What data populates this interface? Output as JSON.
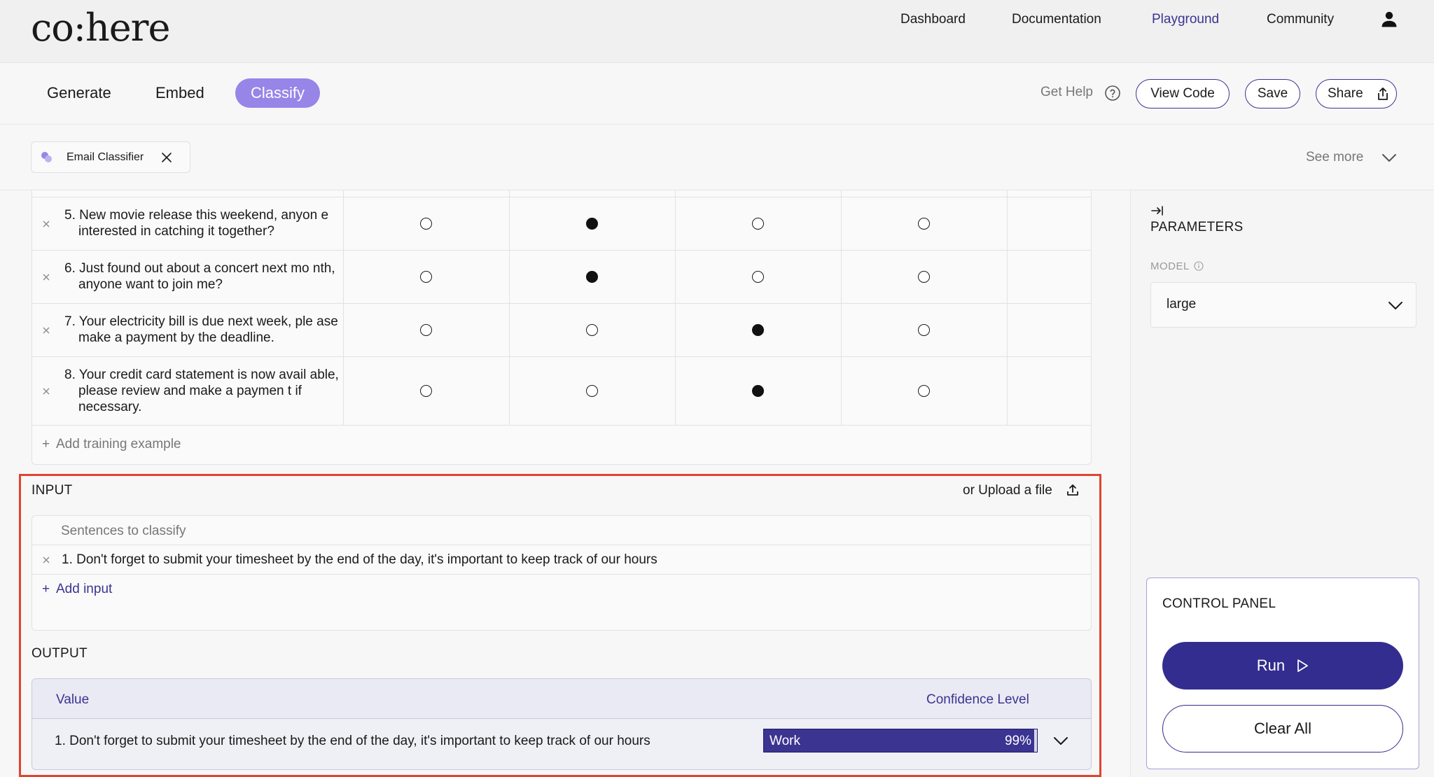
{
  "brand": {
    "logo": "co:here"
  },
  "nav": {
    "links": [
      {
        "label": "Dashboard"
      },
      {
        "label": "Documentation"
      },
      {
        "label": "Playground"
      },
      {
        "label": "Community"
      }
    ],
    "active": "Playground",
    "user_icon": "user-icon"
  },
  "tabs": {
    "items": [
      {
        "label": "Generate"
      },
      {
        "label": "Embed"
      },
      {
        "label": "Classify"
      }
    ],
    "active": "Classify",
    "get_help": "Get Help",
    "view_code": "View Code",
    "save": "Save",
    "share": "Share"
  },
  "preset": {
    "name": "Email Classifier",
    "see_more": "See more"
  },
  "examples": {
    "rows": [
      {
        "text": "5. New movie release this weekend, anyon e interested in catching it together?",
        "selected": 1
      },
      {
        "text": "6. Just found out about a concert next mo nth, anyone want to join me?",
        "selected": 1
      },
      {
        "text": "7. Your electricity bill is due next week, ple ase make a payment by the deadline.",
        "selected": 2
      },
      {
        "text": "8. Your credit card statement is now avail able, please review and make a paymen t if necessary.",
        "selected": 2
      }
    ],
    "add_label": "Add training example"
  },
  "input": {
    "section_label": "INPUT",
    "upload_label": "or Upload a file",
    "header": "Sentences to classify",
    "rows": [
      "1. Don't forget to submit your timesheet by the end of the day, it's important to keep track of our hours"
    ],
    "add_label": "Add input"
  },
  "output": {
    "section_label": "OUTPUT",
    "col_value": "Value",
    "col_confidence": "Confidence Level",
    "rows": [
      {
        "value": "1. Don't forget to submit your timesheet by the end of the day, it's important to keep track of our hours",
        "label": "Work",
        "confidence": "99%",
        "confidence_fraction": 0.99
      }
    ]
  },
  "parameters": {
    "title": "PARAMETERS",
    "model_label": "MODEL",
    "model_value": "large"
  },
  "control_panel": {
    "title": "CONTROL PANEL",
    "run": "Run",
    "clear": "Clear All"
  },
  "colors": {
    "accent": "#3b3491",
    "tab_active": "#9785e8",
    "highlight": "#e04430"
  }
}
